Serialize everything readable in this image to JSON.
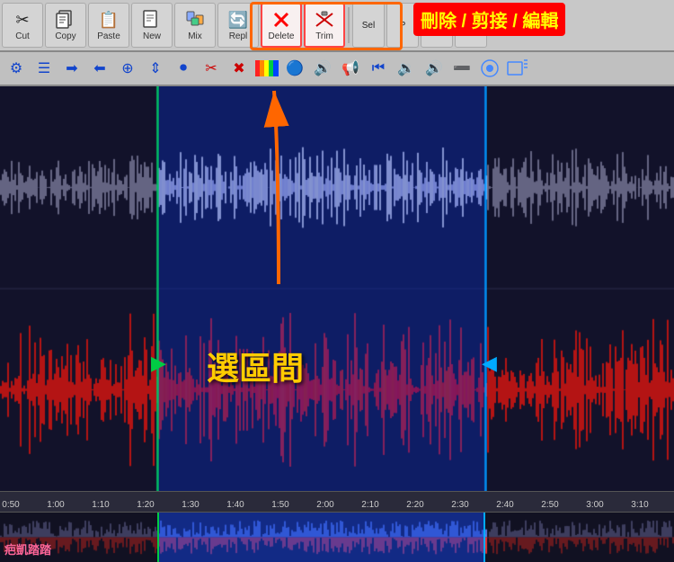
{
  "toolbar": {
    "buttons": [
      {
        "id": "cut",
        "label": "Cut",
        "icon": "✂"
      },
      {
        "id": "copy",
        "label": "Copy",
        "icon": "📋"
      },
      {
        "id": "paste",
        "label": "Paste",
        "icon": "📌"
      },
      {
        "id": "new",
        "label": "New",
        "icon": "📄"
      },
      {
        "id": "mix",
        "label": "Mix",
        "icon": "🎛"
      },
      {
        "id": "repl",
        "label": "Repl",
        "icon": "🔄"
      },
      {
        "id": "delete",
        "label": "Delete",
        "icon": "✕"
      },
      {
        "id": "trim",
        "label": "Trim",
        "icon": "✂"
      }
    ],
    "highlight_label": "刪除 / 剪接 / 編輯"
  },
  "selection_label": "選區間",
  "timeline": {
    "marks": [
      "0:50",
      "1:00",
      "1:10",
      "1:20",
      "1:30",
      "1:40",
      "1:50",
      "2:00",
      "2:10",
      "2:20",
      "2:30",
      "2:40",
      "2:50",
      "3:00",
      "3:10"
    ]
  },
  "overview": {
    "label": "疤凱踏踏"
  },
  "colors": {
    "selection_blue": "#1e4fdc",
    "waveform_white": "#e0e0ff",
    "waveform_blue": "#4466ff",
    "waveform_red": "#ff2222",
    "waveform_gray": "#666688",
    "background": "#12122a",
    "toolbar_bg": "#c8c8c8",
    "highlight": "#ff6600",
    "label_bg": "#ff0000",
    "label_text": "#ffff00"
  }
}
